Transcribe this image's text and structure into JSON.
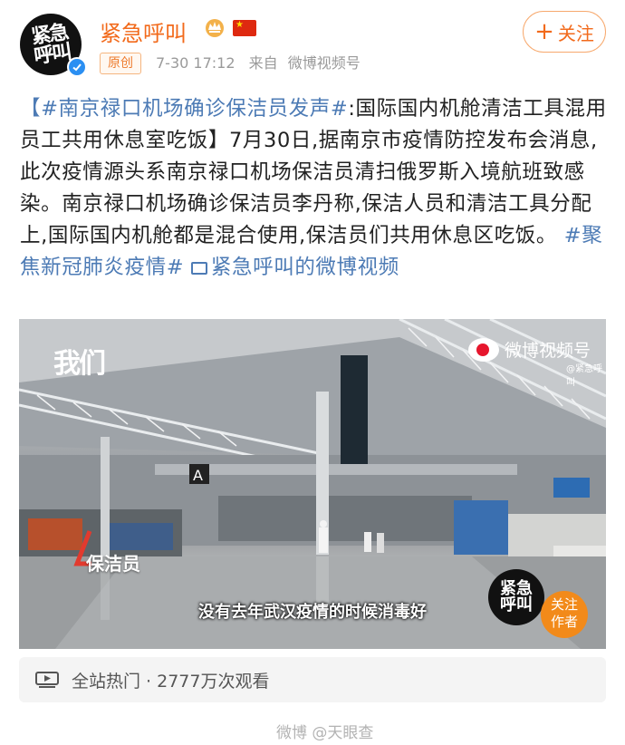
{
  "account": {
    "name": "紧急呼叫",
    "avatar_text": "紧急呼叫",
    "original_badge": "原创",
    "time": "7-30 17:12",
    "source_prefix": "来自",
    "source": "微博视频号",
    "follow_label": "关注"
  },
  "post": {
    "topic": "【#南京禄口机场确诊保洁员发声#",
    "headline": ":国际国内机舱清洁工具混用 员工共用休息室吃饭】",
    "body": "7月30日,据南京市疫情防控发布会消息,此次疫情源头系南京禄口机场保洁员清扫俄罗斯入境航班致感染。南京禄口机场确诊保洁员李丹称,保洁人员和清洁工具分配上,国际国内机舱都是混合使用,保洁员们共用休息区吃饭。",
    "hashtag": "#聚焦新冠肺炎疫情#",
    "video_link": "紧急呼叫的微博视频"
  },
  "video": {
    "corner_logo": "我们",
    "platform_logo": "微博视频号",
    "platform_handle": "@紧急呼叫",
    "role_label": "保洁员",
    "subtitle": "没有去年武汉疫情的时候消毒好",
    "follow_author": "关注作者",
    "gate_sign": "A"
  },
  "stats": {
    "text": "全站热门 · 2777万次观看"
  },
  "watermark": "微博 @天眼查",
  "colors": {
    "accent_orange": "#f26a1b",
    "link_blue": "#4d7bb5",
    "verified_blue": "#2b8ff2"
  }
}
